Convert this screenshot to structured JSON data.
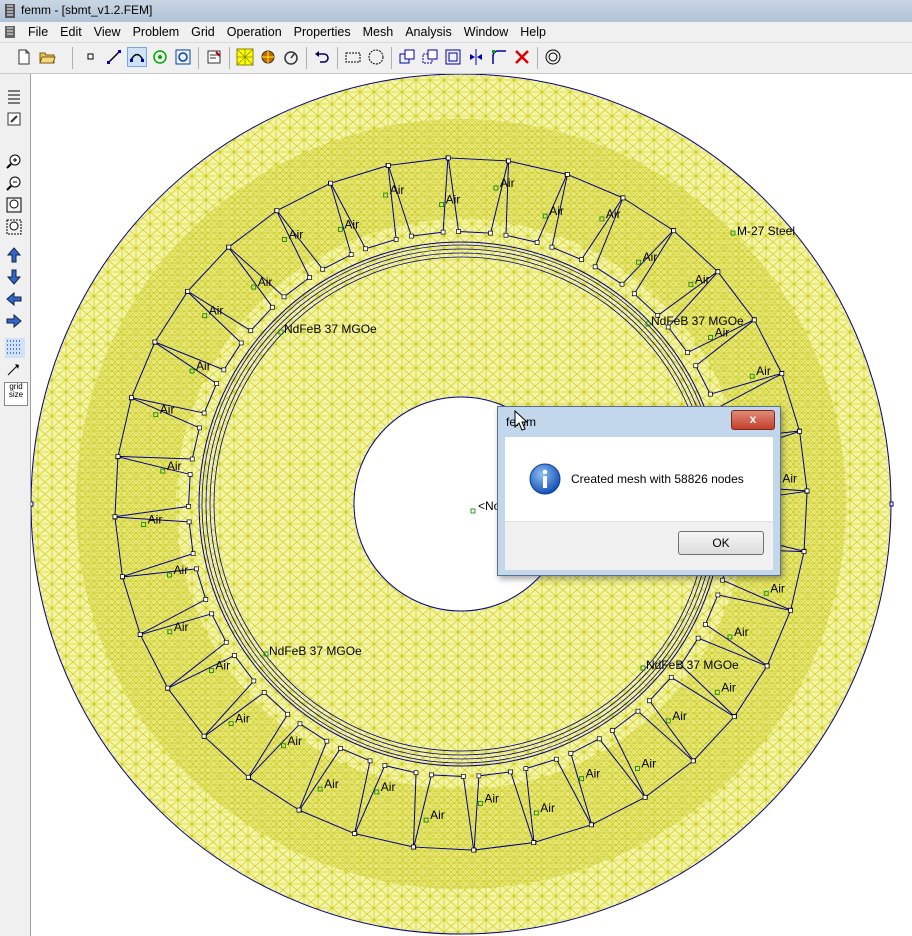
{
  "window": {
    "title": "femm - [sbmt_v1.2.FEM]"
  },
  "menu": [
    "File",
    "Edit",
    "View",
    "Problem",
    "Grid",
    "Operation",
    "Properties",
    "Mesh",
    "Analysis",
    "Window",
    "Help"
  ],
  "toolbar_icons": [
    "new-file-icon",
    "open-file-icon",
    "node-mode-icon",
    "segment-mode-icon",
    "arc-mode-icon",
    "block-mode-icon",
    "group-mode-icon",
    "properties-icon",
    "create-mesh-icon",
    "run-analysis-icon",
    "view-results-icon",
    "undo-icon",
    "select-rectangle-icon",
    "select-circle-icon",
    "copy-icon",
    "move-icon",
    "scale-icon",
    "mirror-icon",
    "fillet-icon",
    "delete-icon",
    "circle-target-icon"
  ],
  "left_toolbar_icons": [
    "show-props-icon",
    "edit-props-icon",
    "zoom-in-icon",
    "zoom-out-icon",
    "zoom-window-icon",
    "zoom-natural-icon",
    "pan-up-icon",
    "pan-down-icon",
    "pan-left-icon",
    "pan-right-icon",
    "show-grid-icon",
    "snap-grid-icon"
  ],
  "left_toolbar": {
    "grid_size_label": "grid size"
  },
  "canvas": {
    "labels": {
      "steel": "M-27 Steel",
      "magnets": [
        "NdFeB 37 MGOe",
        "NdFeB 37 MGOe",
        "NdFeB 37 MGOe",
        "NdFeB 37 MGOe"
      ],
      "air": "Air",
      "partial": "<No"
    },
    "colors": {
      "mesh": "#c8c800",
      "mesh_fill": "#f4f4a8",
      "geometry": "#00008b",
      "label_marker": "#008000"
    }
  },
  "dialog": {
    "title": "femm",
    "message": "Created mesh with 58826 nodes",
    "ok_label": "OK",
    "close_label": "x"
  }
}
